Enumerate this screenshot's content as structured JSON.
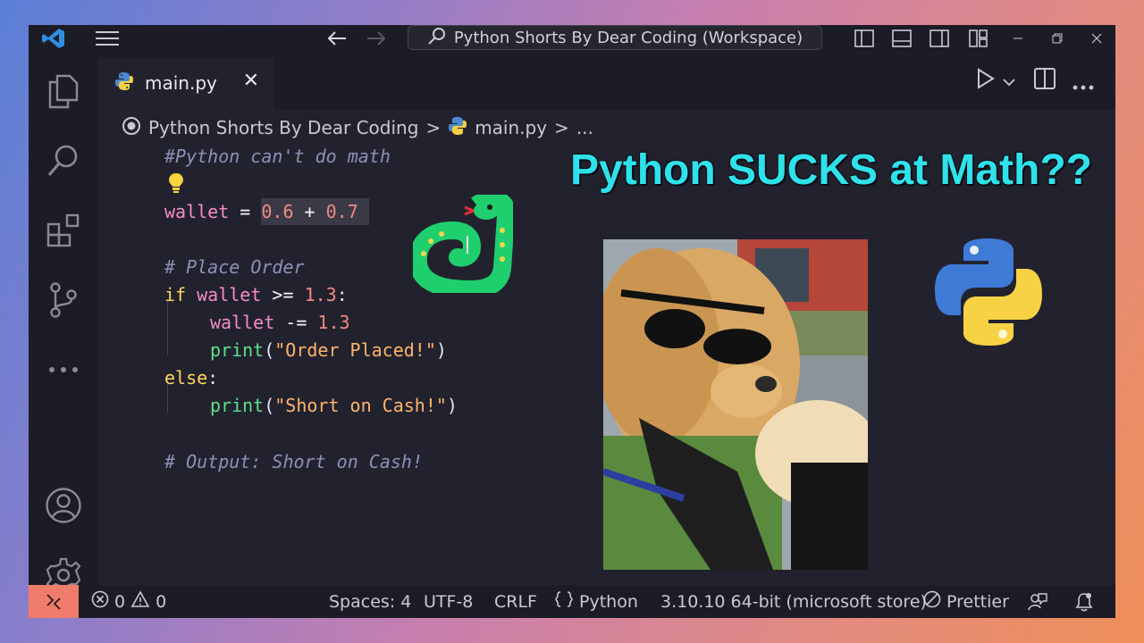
{
  "titlebar": {
    "search_text": "Python Shorts By Dear Coding (Workspace)"
  },
  "tab": {
    "label": "main.py",
    "close_glyph": "✕"
  },
  "breadcrumb": {
    "workspace": "Python Shorts By Dear Coding",
    "sep1": ">",
    "file": "main.py",
    "sep2": ">",
    "more": "..."
  },
  "code": {
    "l1": "#Python can't do math",
    "l3": {
      "var": "wallet",
      "op": " = ",
      "n1": "0.6",
      "plus": " + ",
      "n2": "0.7"
    },
    "l5": "# Place Order",
    "l6": {
      "kw": "if",
      "var": " wallet",
      "op": " >= ",
      "num": "1.3",
      "colon": ":"
    },
    "l7": {
      "var": "wallet",
      "op": " -= ",
      "num": "1.3"
    },
    "l8": {
      "fn": "print",
      "open": "(",
      "str": "\"Order Placed!\"",
      "close": ")"
    },
    "l9": {
      "kw": "else",
      "colon": ":"
    },
    "l10": {
      "fn": "print",
      "open": "(",
      "str": "\"Short on Cash!\"",
      "close": ")"
    },
    "l12": "# Output: Short on Cash!"
  },
  "overlay": {
    "headline": "Python SUCKS at Math??"
  },
  "statusbar": {
    "errors": "0",
    "warnings": "0",
    "spaces": "Spaces: 4",
    "encoding": "UTF-8",
    "eol": "CRLF",
    "language": "Python",
    "interpreter": "3.10.10 64-bit (microsoft store)",
    "formatter": "Prettier"
  },
  "colors": {
    "accent_cyan": "#2fe1ea",
    "remote_indicator": "#f07c6c",
    "editor_bg": "#22222e"
  }
}
